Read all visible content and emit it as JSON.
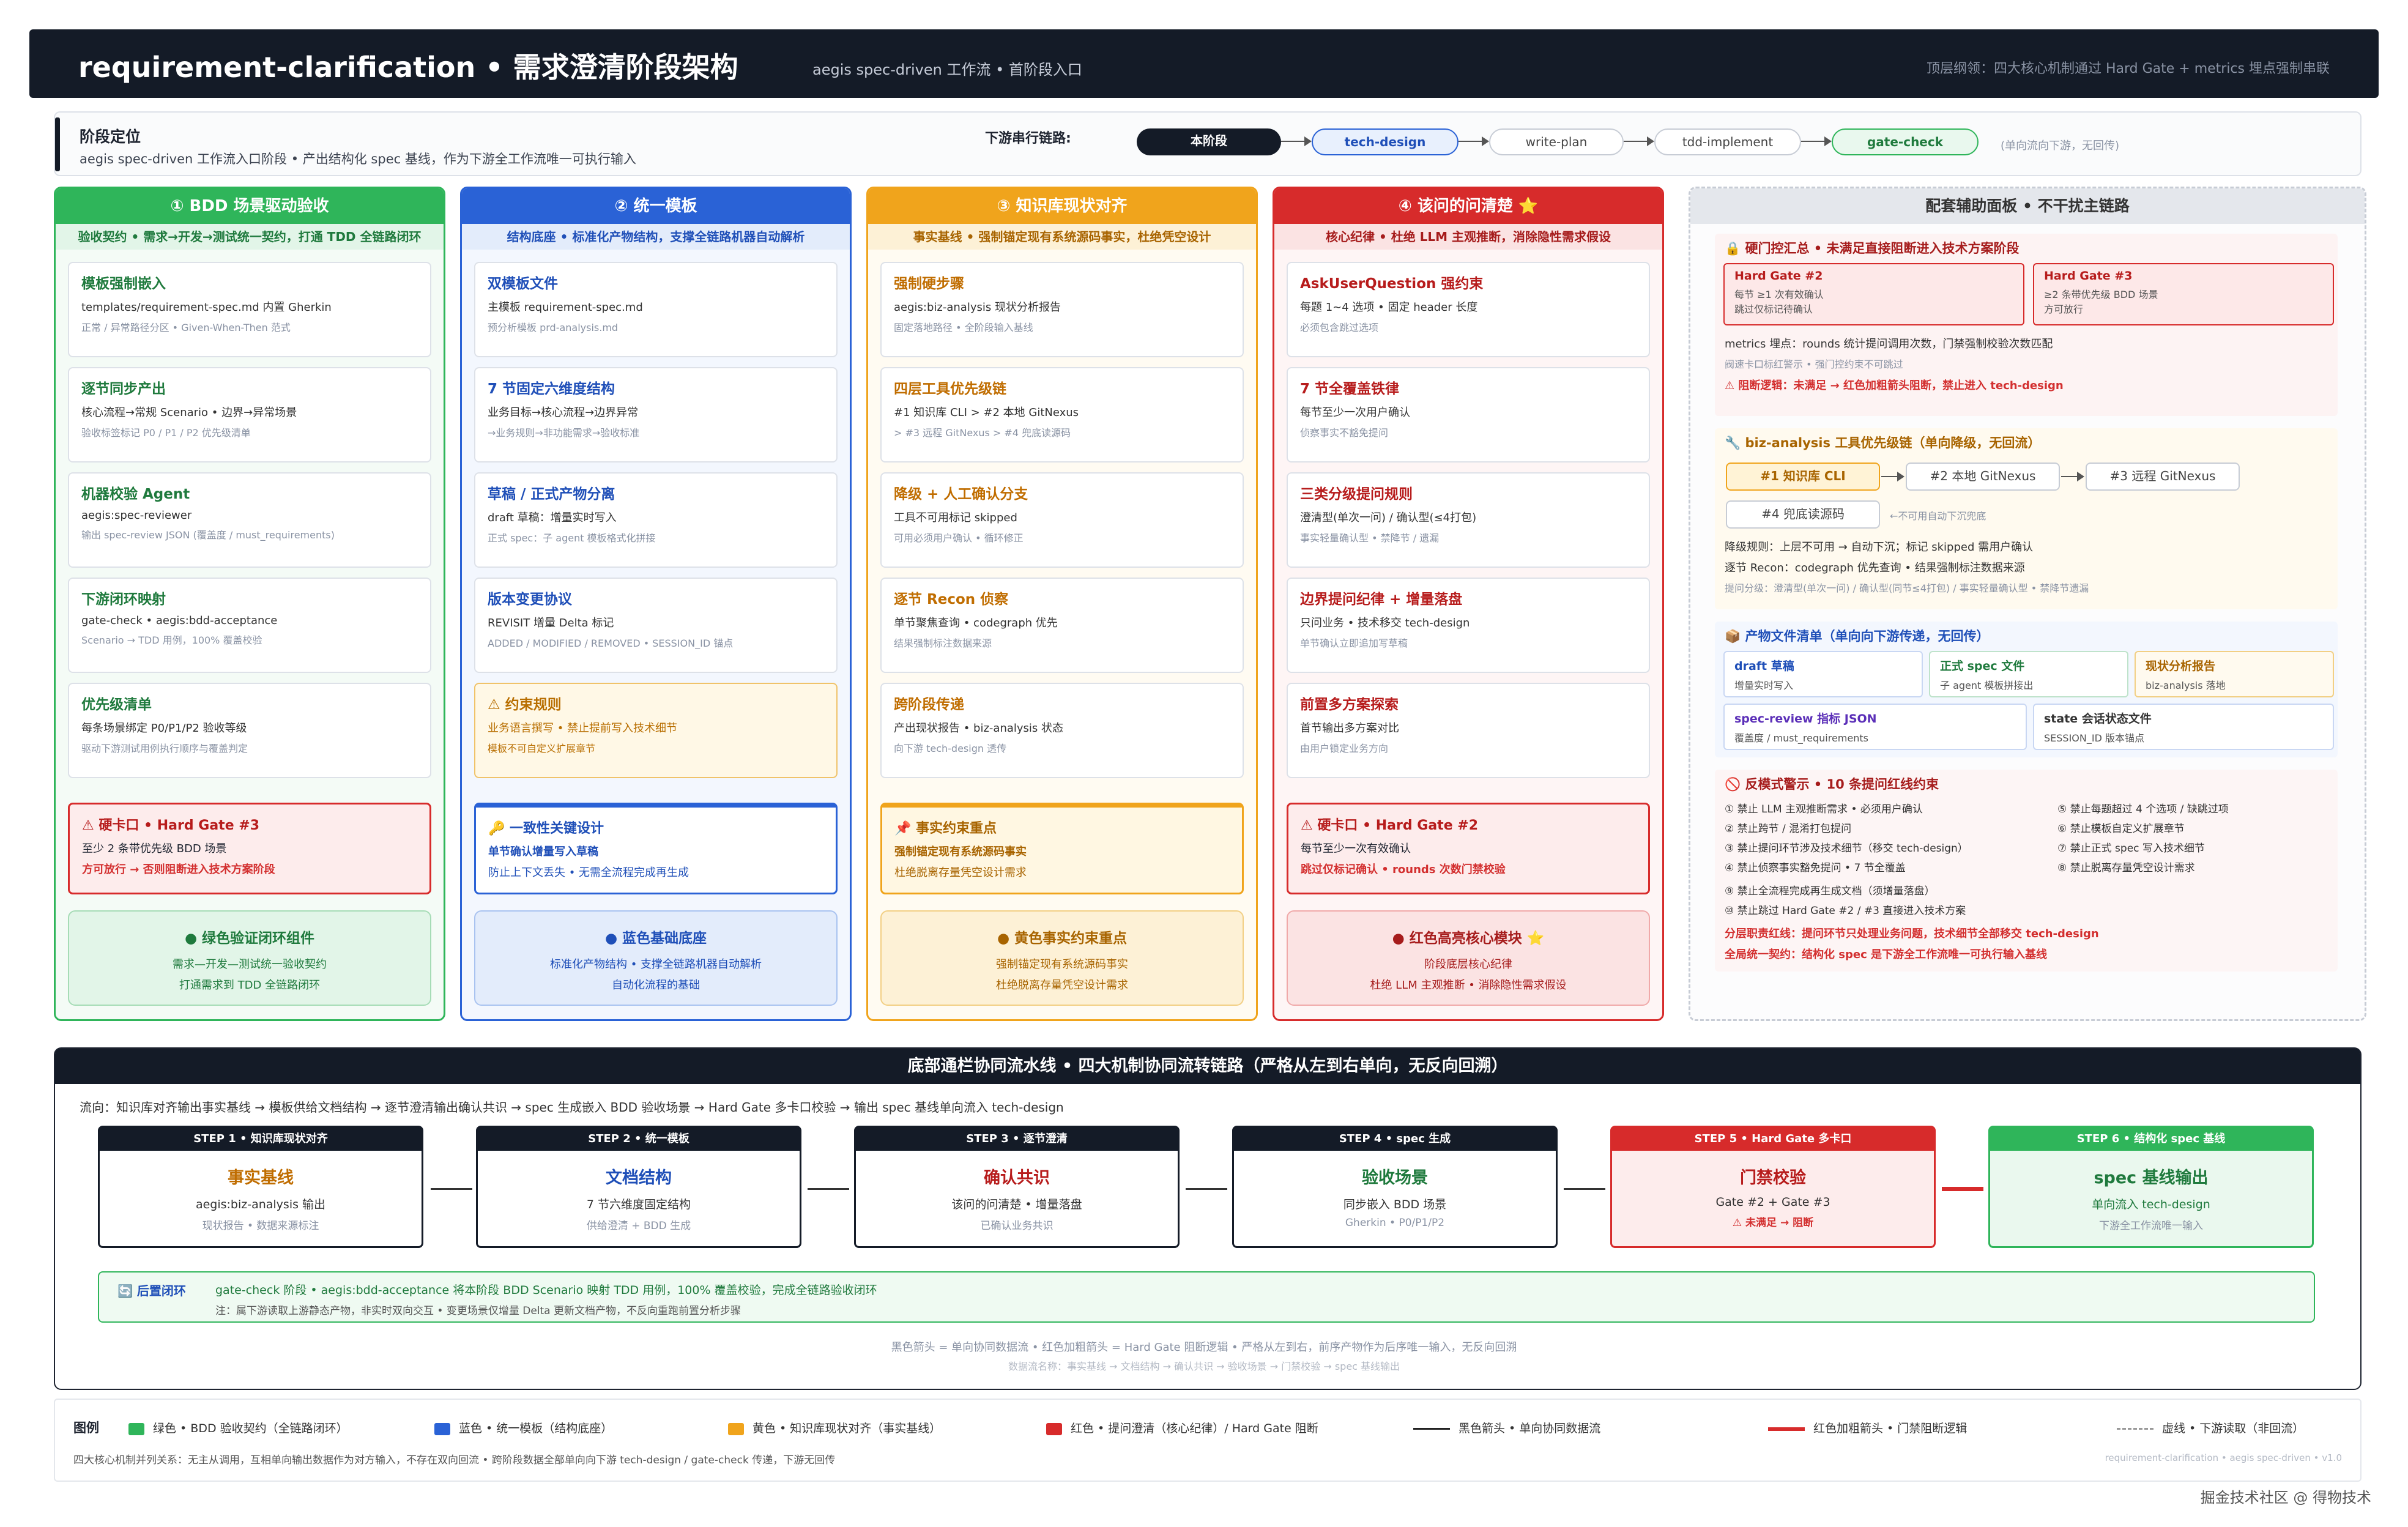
{
  "topbar": {
    "title": "requirement-clarification • 需求澄清阶段架构",
    "subtitle": "aegis spec-driven 工作流 • 首阶段入口",
    "right": "顶层纲领：四大核心机制通过 Hard Gate + metrics 埋点强制串联"
  },
  "stage": {
    "heading": "阶段定位",
    "desc": "aegis spec-driven 工作流入口阶段 • 产出结构化 spec 基线，作为下游全工作流唯一可执行输入",
    "chain_label": "下游串行链路:",
    "chain": [
      "本阶段",
      "tech-design",
      "write-plan",
      "tdd-implement",
      "gate-check"
    ],
    "chain_note": "(单向流向下游，无回传)"
  },
  "columns": [
    {
      "title": "① BDD 场景驱动验收",
      "sub": "验收契约 • 需求→开发→测试统一契约，打通 TDD 全链路闭环",
      "cards": [
        {
          "t": "模板强制嵌入",
          "d": "templates/requirement-spec.md 内置 Gherkin",
          "s": "正常 / 异常路径分区 • Given-When-Then 范式"
        },
        {
          "t": "逐节同步产出",
          "d": "核心流程→常规 Scenario • 边界→异常场景",
          "s": "验收标签标记 P0 / P1 / P2 优先级清单"
        },
        {
          "t": "机器校验 Agent",
          "d": "aegis:spec-reviewer",
          "s": "输出 spec-review JSON (覆盖度 / must_requirements)"
        },
        {
          "t": "下游闭环映射",
          "d": "gate-check • aegis:bdd-acceptance",
          "s": "Scenario → TDD 用例，100% 覆盖校验"
        },
        {
          "t": "优先级清单",
          "d": "每条场景绑定 P0/P1/P2 验收等级",
          "s": "驱动下游测试用例执行顺序与覆盖判定"
        }
      ],
      "hard": {
        "t": "⚠ 硬卡口 • Hard Gate #3",
        "d": "至少 2 条带优先级 BDD 场景",
        "s": "方可放行 → 否则阻断进入技术方案阶段"
      },
      "summ": {
        "t": "● 绿色验证闭环组件",
        "d1": "需求—开发—测试统一验收契约",
        "d2": "打通需求到 TDD 全链路闭环"
      }
    },
    {
      "title": "② 统一模板",
      "sub": "结构底座 • 标准化产物结构，支撑全链路机器自动解析",
      "cards": [
        {
          "t": "双模板文件",
          "d": "主模板 requirement-spec.md",
          "s": "预分析模板 prd-analysis.md"
        },
        {
          "t": "7 节固定六维度结构",
          "d": "业务目标→核心流程→边界异常",
          "s": "→业务规则→非功能需求→验收标准"
        },
        {
          "t": "草稿 / 正式产物分离",
          "d": "draft 草稿：增量实时写入",
          "s": "正式 spec：子 agent 模板格式化拼接"
        },
        {
          "t": "版本变更协议",
          "d": "REVISIT 增量 Delta 标记",
          "s": "ADDED / MODIFIED / REMOVED • SESSION_ID 锚点"
        },
        {
          "t": "⚠ 约束规则",
          "d": "业务语言撰写 • 禁止提前写入技术细节",
          "s": "模板不可自定义扩展章节"
        }
      ],
      "hard": {
        "t": "🔑 一致性关键设计",
        "d": "单节确认增量写入草稿",
        "s": "防止上下文丢失 • 无需全流程完成再生成"
      },
      "summ": {
        "t": "● 蓝色基础底座",
        "d1": "标准化产物结构 • 支撑全链路机器自动解析",
        "d2": "自动化流程的基础"
      }
    },
    {
      "title": "③ 知识库现状对齐",
      "sub": "事实基线 • 强制锚定现有系统源码事实，杜绝凭空设计",
      "cards": [
        {
          "t": "强制硬步骤",
          "d": "aegis:biz-analysis 现状分析报告",
          "s": "固定落地路径 • 全阶段输入基线"
        },
        {
          "t": "四层工具优先级链",
          "d": "#1 知识库 CLI > #2 本地 GitNexus",
          "s": "> #3 远程 GitNexus > #4 兜底读源码"
        },
        {
          "t": "降级 + 人工确认分支",
          "d": "工具不可用标记 skipped",
          "s": "可用必须用户确认 • 循环修正"
        },
        {
          "t": "逐节 Recon 侦察",
          "d": "单节聚焦查询 • codegraph 优先",
          "s": "结果强制标注数据来源"
        },
        {
          "t": "跨阶段传递",
          "d": "产出现状报告 • biz-analysis 状态",
          "s": "向下游 tech-design 透传"
        }
      ],
      "hard": {
        "t": "📌 事实约束重点",
        "d": "强制锚定现有系统源码事实",
        "s": "杜绝脱离存量凭空设计需求"
      },
      "summ": {
        "t": "● 黄色事实约束重点",
        "d1": "强制锚定现有系统源码事实",
        "d2": "杜绝脱离存量凭空设计需求"
      }
    },
    {
      "title": "④ 该问的问清楚 ⭐",
      "sub": "核心纪律 • 杜绝 LLM 主观推断，消除隐性需求假设",
      "cards": [
        {
          "t": "AskUserQuestion 强约束",
          "d": "每题 1~4 选项 • 固定 header 长度",
          "s": "必须包含跳过选项"
        },
        {
          "t": "7 节全覆盖铁律",
          "d": "每节至少一次用户确认",
          "s": "侦察事实不豁免提问"
        },
        {
          "t": "三类分级提问规则",
          "d": "澄清型(单次一问) / 确认型(≤4打包)",
          "s": "事实轻量确认型 • 禁降节 / 遗漏"
        },
        {
          "t": "边界提问纪律 + 增量落盘",
          "d": "只问业务 • 技术移交 tech-design",
          "s": "单节确认立即追加写草稿"
        },
        {
          "t": "前置多方案探索",
          "d": "首节输出多方案对比",
          "s": "由用户锁定业务方向"
        }
      ],
      "hard": {
        "t": "⚠ 硬卡口 • Hard Gate #2",
        "d": "每节至少一次有效确认",
        "s": "跳过仅标记确认 • rounds 次数门禁校验"
      },
      "summ": {
        "t": "● 红色高亮核心模块 ⭐",
        "d1": "阶段底层核心纪律",
        "d2": "杜绝 LLM 主观推断 • 消除隐性需求假设"
      }
    }
  ],
  "side": {
    "title": "配套辅助面板 • 不干扰主链路",
    "p1": {
      "h": "🔒 硬门控汇总 • 未满足直接阻断进入技术方案阶段",
      "g2t": "Hard Gate #2",
      "g2d1": "每节 ≥1 次有效确认",
      "g2d2": "跳过仅标记待确认",
      "g3t": "Hard Gate #3",
      "g3d1": "≥2 条带优先级 BDD 场景",
      "g3d2": "方可放行",
      "m1": "metrics 埋点：rounds 统计提问调用次数，门禁强制校验次数匹配",
      "m2": "阀速卡口标红警示 • 强门控约束不可跳过",
      "m3": "⚠ 阻断逻辑：未满足 → 红色加粗箭头阻断，禁止进入 tech-design"
    },
    "p2": {
      "h": "🔧 biz-analysis 工具优先级链（单向降级，无回流）",
      "tools": [
        "#1 知识库 CLI",
        "#2 本地 GitNexus",
        "#3 远程 GitNexus",
        "#4 兜底读源码"
      ],
      "t4note": "←不可用自动下沉兜底",
      "l1": "降级规则：上层不可用 → 自动下沉；标记 skipped 需用户确认",
      "l2": "逐节 Recon：codegraph 优先查询 • 结果强制标注数据来源",
      "l3": "提问分级：澄清型(单次一问) / 确认型(同节≤4打包) / 事实轻量确认型 • 禁降节遗漏"
    },
    "p3": {
      "h": "📦 产物文件清单（单向向下游传递，无回传）",
      "files": [
        {
          "t": "draft 草稿",
          "d": "增量实时写入"
        },
        {
          "t": "正式 spec 文件",
          "d": "子 agent 模板拼接出"
        },
        {
          "t": "现状分析报告",
          "d": "biz-analysis 落地"
        },
        {
          "t": "spec-review 指标 JSON",
          "d": "覆盖度 / must_requirements"
        },
        {
          "t": "state 会话状态文件",
          "d": "SESSION_ID 版本锚点"
        }
      ]
    },
    "p4": {
      "h": "🚫 反模式警示 • 10 条提问红线约束",
      "left": [
        "① 禁止 LLM 主观推断需求 • 必须用户确认",
        "② 禁止跨节 / 混淆打包提问",
        "③ 禁止提问环节涉及技术细节（移交 tech-design）",
        "④ 禁止侦察事实豁免提问 • 7 节全覆盖",
        "⑨ 禁止全流程完成再生成文档（须增量落盘）",
        "⑩ 禁止跳过 Hard Gate #2 / #3 直接进入技术方案"
      ],
      "right": [
        "⑤ 禁止每题超过 4 个选项 / 缺跳过项",
        "⑥ 禁止模板自定义扩展章节",
        "⑦ 禁止正式 spec 写入技术细节",
        "⑧ 禁止脱离存量凭空设计需求"
      ],
      "r1": "分层职责红线：提问环节只处理业务问题，技术细节全部移交 tech-design",
      "r2": "全局统一契约：结构化 spec 是下游全工作流唯一可执行输入基线"
    }
  },
  "pipeline": {
    "title": "底部通栏协同流水线 • 四大机制协同流转链路（严格从左到右单向，无反向回溯）",
    "flow": "流向：知识库对齐输出事实基线 → 模板供给文档结构 → 逐节澄清输出确认共识 → spec 生成嵌入 BDD 验收场景 → Hard Gate 多卡口校验 → 输出 spec 基线单向流入 tech-design",
    "steps": [
      {
        "h": "STEP 1 • 知识库现状对齐",
        "t": "事实基线",
        "d": "aegis:biz-analysis 输出",
        "s": "现状报告 • 数据来源标注"
      },
      {
        "h": "STEP 2 • 统一模板",
        "t": "文档结构",
        "d": "7 节六维度固定结构",
        "s": "供给澄清 + BDD 生成"
      },
      {
        "h": "STEP 3 • 逐节澄清",
        "t": "确认共识",
        "d": "该问的问清楚 • 增量落盘",
        "s": "已确认业务共识"
      },
      {
        "h": "STEP 4 • spec 生成",
        "t": "验收场景",
        "d": "同步嵌入 BDD 场景",
        "s": "Gherkin • P0/P1/P2"
      },
      {
        "h": "STEP 5 • Hard Gate 多卡口",
        "t": "门禁校验",
        "d": "Gate #2 + Gate #3",
        "s": "⚠ 未满足 → 阻断"
      },
      {
        "h": "STEP 6 • 结构化 spec 基线",
        "t": "spec 基线输出",
        "d": "单向流入 tech-design",
        "s": "下游全工作流唯一输入"
      }
    ],
    "post_label": "🔄 后置闭环",
    "post_text": "gate-check 阶段 • aegis:bdd-acceptance 将本阶段 BDD Scenario 映射 TDD 用例，100% 覆盖校验，完成全链路验收闭环",
    "post_note": "注：属下游读取上游静态产物，非实时双向交互 • 变更场景仅增量 Delta 更新文档产物，不反向重跑前置分析步骤",
    "foot1": "黑色箭头 = 单向协同数据流 • 红色加粗箭头 = Hard Gate 阻断逻辑 • 严格从左到右，前序产物作为后序唯一输入，无反向回溯",
    "foot2": "数据流名称：事实基线 → 文档结构 → 确认共识 → 验收场景 → 门禁校验 → spec 基线输出"
  },
  "legend": {
    "label": "图例",
    "items": [
      "绿色 • BDD 验收契约（全链路闭环）",
      "蓝色 • 统一模板（结构底座）",
      "黄色 • 知识库现状对齐（事实基线）",
      "红色 • 提问澄清（核心纪律）/ Hard Gate 阻断",
      "黑色箭头 • 单向协同数据流",
      "红色加粗箭头 • 门禁阻断逻辑",
      "虚线 • 下游读取（非回流）"
    ],
    "foot": "四大核心机制并列关系：无主从调用，互相单向输出数据作为对方输入，不存在双向回流 • 跨阶段数据全部单向向下游 tech-design / gate-check 传递，下游无回传",
    "version": "requirement-clarification • aegis spec-driven • v1.0"
  },
  "watermark": "掘金技术社区 @ 得物技术",
  "colors": {
    "green": "#2fb55a",
    "blue": "#2a62d6",
    "yellow": "#f0a41c",
    "red": "#d72b2b",
    "dark": "#141b27"
  }
}
